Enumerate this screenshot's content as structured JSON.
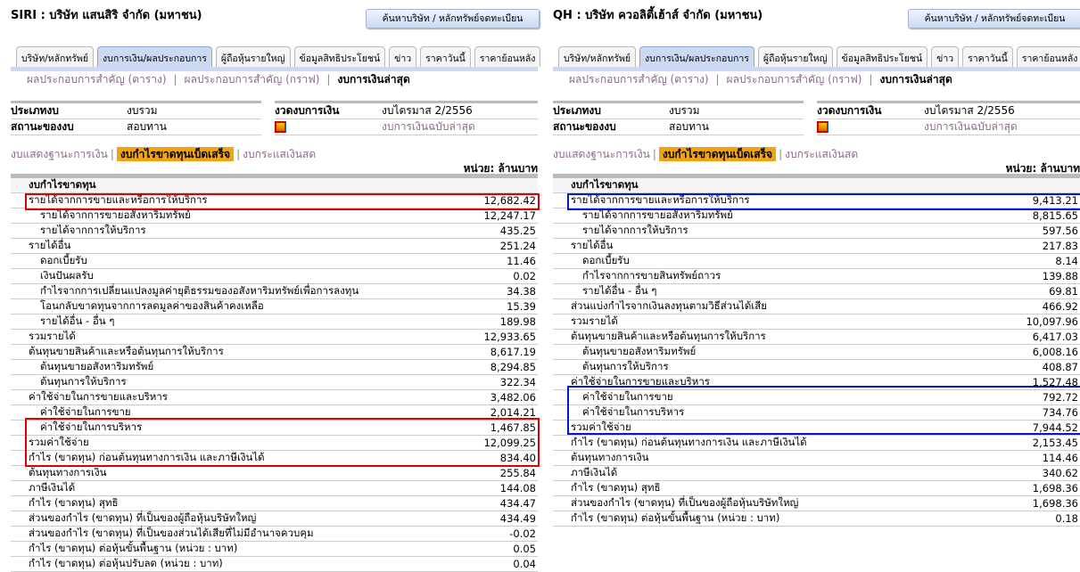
{
  "panels": [
    {
      "title": "SIRI : บริษัท แสนสิริ จำกัด (มหาชน)",
      "search_button": "ค้นหาบริษัท / หลักทรัพย์จดทะเบียน",
      "tabs": [
        "บริษัท/หลักทรัพย์",
        "งบการเงิน/ผลประกอบการ",
        "ผู้ถือหุ้นรายใหญ่",
        "ข้อมูลสิทธิประโยชน์",
        "ข่าว",
        "ราคาวันนี้",
        "ราคาย้อนหลัง"
      ],
      "active_tab": 1,
      "subnav": [
        "ผลประกอบการสำคัญ (ตาราง)",
        "ผลประกอบการสำคัญ (กราฟ)",
        "งบการเงินล่าสุด"
      ],
      "info": {
        "type_label": "ประเภทงบ",
        "type_value": "งบรวม",
        "status_label": "สถานะของงบ",
        "status_value": "สอบทาน",
        "period_label": "งวดงบการเงิน",
        "period_value": "งบไตรมาส 2/2556",
        "latest_link": "งบการเงินฉบับล่าสุด"
      },
      "statements": [
        "งบแสดงฐานะการเงิน",
        "งบกำไรขาดทุนเบ็ดเสร็จ",
        "งบกระแสเงินสด"
      ],
      "unit": "หน่วย: ล้านบาท",
      "header": "งบกำไรขาดทุน",
      "highlight_color": "#e00000",
      "highlights": [
        [
          0,
          0
        ],
        [
          14,
          16
        ]
      ],
      "rows": [
        [
          "รายได้จากการขายและหรือการให้บริการ",
          "12,682.42",
          0
        ],
        [
          "รายได้จากการขายอสังหาริมทรัพย์",
          "12,247.17",
          1
        ],
        [
          "รายได้จากการให้บริการ",
          "435.25",
          1
        ],
        [
          "รายได้อื่น",
          "251.24",
          0
        ],
        [
          "ดอกเบี้ยรับ",
          "11.46",
          1
        ],
        [
          "เงินปันผลรับ",
          "0.02",
          1
        ],
        [
          "กำไรจากการเปลี่ยนแปลงมูลค่ายุติธรรมของอสังหาริมทรัพย์เพื่อการลงทุน",
          "34.38",
          1
        ],
        [
          "โอนกลับขาดทุนจากการลดมูลค่าของสินค้าคงเหลือ",
          "15.39",
          1
        ],
        [
          "รายได้อื่น - อื่น ๆ",
          "189.98",
          1
        ],
        [
          "รวมรายได้",
          "12,933.65",
          0
        ],
        [
          "ต้นทุนขายสินค้าและหรือต้นทุนการให้บริการ",
          "8,617.19",
          0
        ],
        [
          "ต้นทุนขายอสังหาริมทรัพย์",
          "8,294.85",
          1
        ],
        [
          "ต้นทุนการให้บริการ",
          "322.34",
          1
        ],
        [
          "ค่าใช้จ่ายในการขายและบริหาร",
          "3,482.06",
          0
        ],
        [
          "ค่าใช้จ่ายในการขาย",
          "2,014.21",
          1
        ],
        [
          "ค่าใช้จ่ายในการบริหาร",
          "1,467.85",
          1
        ],
        [
          "รวมค่าใช้จ่าย",
          "12,099.25",
          0
        ],
        [
          "กำไร (ขาดทุน) ก่อนต้นทุนทางการเงิน และภาษีเงินได้",
          "834.40",
          0
        ],
        [
          "ต้นทุนทางการเงิน",
          "255.84",
          0
        ],
        [
          "ภาษีเงินได้",
          "144.08",
          0
        ],
        [
          "กำไร (ขาดทุน) สุทธิ",
          "434.47",
          0
        ],
        [
          "ส่วนของกำไร (ขาดทุน) ที่เป็นของผู้ถือหุ้นบริษัทใหญ่",
          "434.49",
          0
        ],
        [
          "ส่วนของกำไร (ขาดทุน) ที่เป็นของส่วนได้เสียที่ไม่มีอำนาจควบคุม",
          "-0.02",
          0
        ],
        [
          "กำไร (ขาดทุน) ต่อหุ้นขั้นพื้นฐาน (หน่วย : บาท)",
          "0.05",
          0
        ],
        [
          "กำไร (ขาดทุน) ต่อหุ้นปรับลด (หน่วย : บาท)",
          "0.04",
          0
        ]
      ]
    },
    {
      "title": "QH : บริษัท ควอลิตี้เฮ้าส์ จำกัด (มหาชน)",
      "search_button": "ค้นหาบริษัท / หลักทรัพย์จดทะเบียน",
      "tabs": [
        "บริษัท/หลักทรัพย์",
        "งบการเงิน/ผลประกอบการ",
        "ผู้ถือหุ้นรายใหญ่",
        "ข้อมูลสิทธิประโยชน์",
        "ข่าว",
        "ราคาวันนี้",
        "ราคาย้อนหลัง"
      ],
      "active_tab": 1,
      "subnav": [
        "ผลประกอบการสำคัญ (ตาราง)",
        "ผลประกอบการสำคัญ (กราฟ)",
        "งบการเงินล่าสุด"
      ],
      "info": {
        "type_label": "ประเภทงบ",
        "type_value": "งบรวม",
        "status_label": "สถานะของงบ",
        "status_value": "สอบทาน",
        "period_label": "งวดงบการเงิน",
        "period_value": "งบไตรมาส 2/2556",
        "latest_link": "งบการเงินฉบับล่าสุด"
      },
      "statements": [
        "งบแสดงฐานะการเงิน",
        "งบกำไรขาดทุนเบ็ดเสร็จ",
        "งบกระแสเงินสด"
      ],
      "unit": "หน่วย: ล้านบาท",
      "header": "งบกำไรขาดทุน",
      "highlight_color": "#0018d0",
      "highlights": [
        [
          0,
          0
        ],
        [
          12,
          14
        ]
      ],
      "rows": [
        [
          "รายได้จากการขายและหรือการให้บริการ",
          "9,413.21",
          0
        ],
        [
          "รายได้จากการขายอสังหาริมทรัพย์",
          "8,815.65",
          1
        ],
        [
          "รายได้จากการให้บริการ",
          "597.56",
          1
        ],
        [
          "รายได้อื่น",
          "217.83",
          0
        ],
        [
          "ดอกเบี้ยรับ",
          "8.14",
          1
        ],
        [
          "กำไรจากการขายสินทรัพย์ถาวร",
          "139.88",
          1
        ],
        [
          "รายได้อื่น - อื่น ๆ",
          "69.81",
          1
        ],
        [
          "ส่วนแบ่งกำไรจากเงินลงทุนตามวิธีส่วนได้เสีย",
          "466.92",
          0
        ],
        [
          "รวมรายได้",
          "10,097.96",
          0
        ],
        [
          "ต้นทุนขายสินค้าและหรือต้นทุนการให้บริการ",
          "6,417.03",
          0
        ],
        [
          "ต้นทุนขายอสังหาริมทรัพย์",
          "6,008.16",
          1
        ],
        [
          "ต้นทุนการให้บริการ",
          "408.87",
          1
        ],
        [
          "ค่าใช้จ่ายในการขายและบริหาร",
          "1,527.48",
          0
        ],
        [
          "ค่าใช้จ่ายในการขาย",
          "792.72",
          1
        ],
        [
          "ค่าใช้จ่ายในการบริหาร",
          "734.76",
          1
        ],
        [
          "รวมค่าใช้จ่าย",
          "7,944.52",
          0
        ],
        [
          "กำไร (ขาดทุน) ก่อนต้นทุนทางการเงิน และภาษีเงินได้",
          "2,153.45",
          0
        ],
        [
          "ต้นทุนทางการเงิน",
          "114.46",
          0
        ],
        [
          "ภาษีเงินได้",
          "340.62",
          0
        ],
        [
          "กำไร (ขาดทุน) สุทธิ",
          "1,698.36",
          0
        ],
        [
          "ส่วนของกำไร (ขาดทุน) ที่เป็นของผู้ถือหุ้นบริษัทใหญ่",
          "1,698.36",
          0
        ],
        [
          "กำไร (ขาดทุน) ต่อหุ้นขั้นพื้นฐาน (หน่วย : บาท)",
          "0.18",
          0
        ]
      ]
    }
  ]
}
